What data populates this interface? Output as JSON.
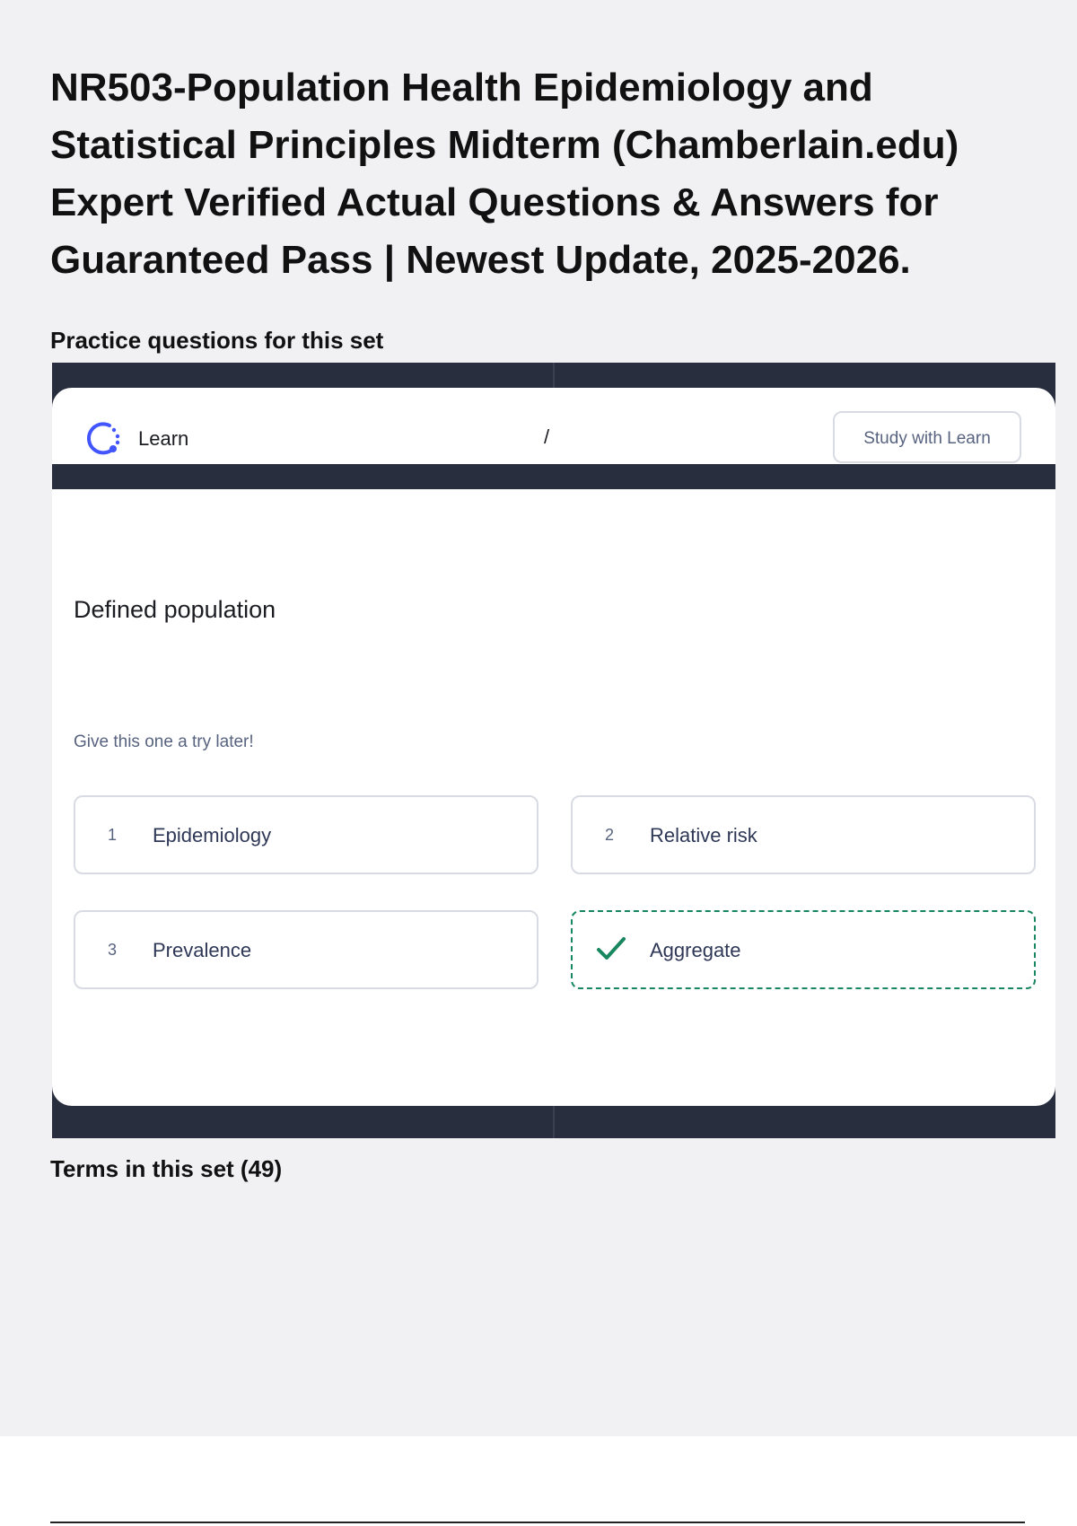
{
  "document": {
    "title": "NR503-Population Health Epidemiology and Statistical Principles Midterm (Chamberlain.edu) Expert Verified Actual Questions & Answers for Guaranteed Pass | Newest Update, 2025-2026.",
    "practice_heading": "Practice questions for this set",
    "terms_heading": "Terms in this set (49)"
  },
  "widget": {
    "header": {
      "mode_label": "Learn",
      "mode_icon": "learn-progress-icon",
      "separator": "/",
      "study_button_label": "Study with Learn"
    },
    "question": {
      "term": "Defined population",
      "hint": "Give this one a try later!"
    },
    "options": [
      {
        "number": "1",
        "label": "Epidemiology",
        "correct": false
      },
      {
        "number": "2",
        "label": "Relative risk",
        "correct": false
      },
      {
        "number": "3",
        "label": "Prevalence",
        "correct": false
      },
      {
        "number": "",
        "label": "Aggregate",
        "correct": true,
        "icon": "check-icon"
      }
    ]
  },
  "colors": {
    "page_background": "#f1f1f3",
    "widget_frame": "#282e3e",
    "accent_blue": "#4255ff",
    "correct_green": "#18865f"
  }
}
